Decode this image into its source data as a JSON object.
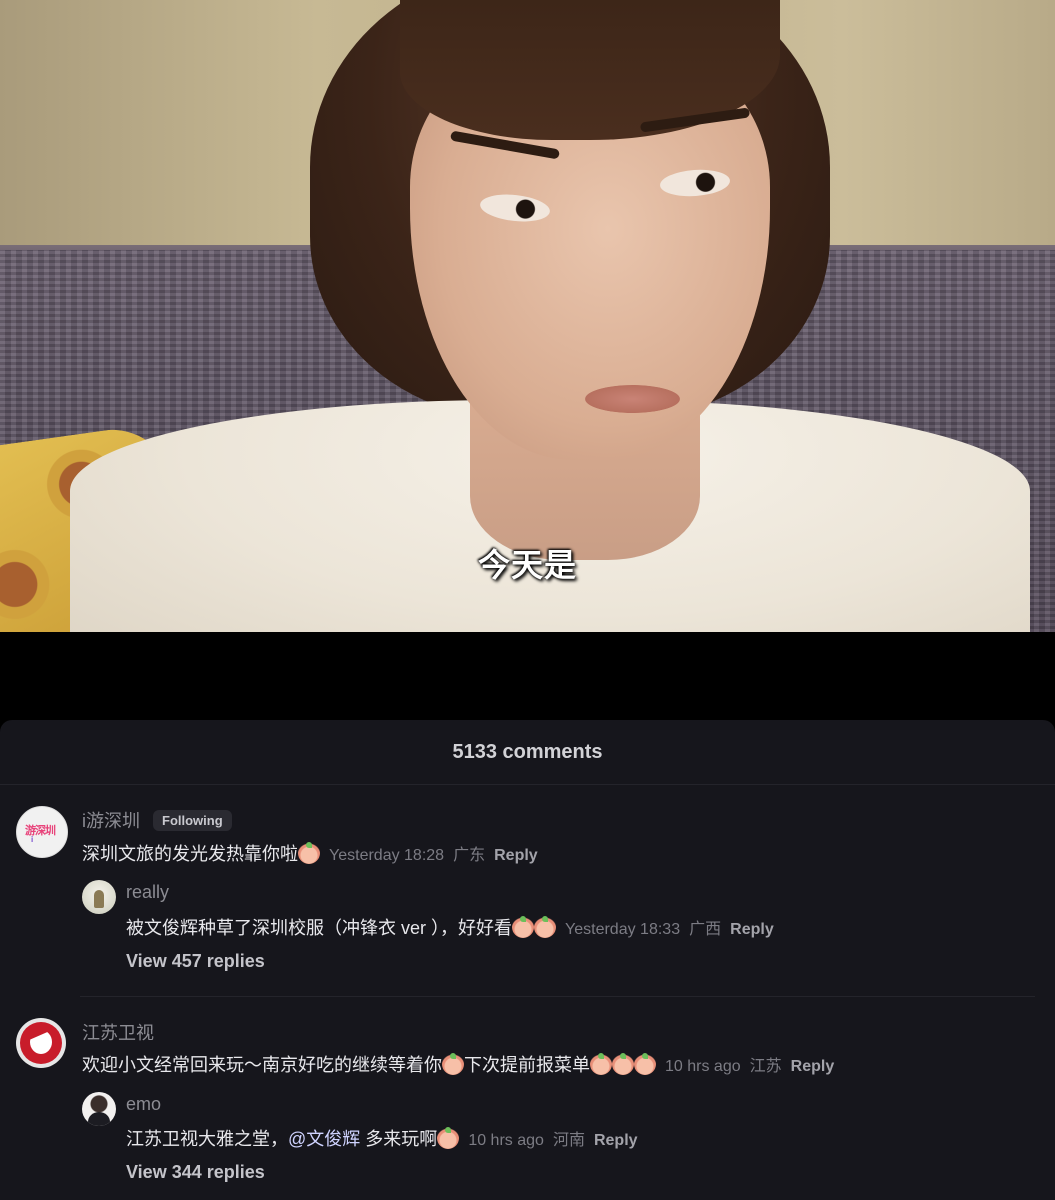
{
  "video": {
    "subtitle": "今天是"
  },
  "comments_panel": {
    "title": "5133 comments",
    "threads": [
      {
        "author": "i游深圳",
        "avatar_text": "游深圳",
        "avatar_subtext": "i",
        "badge": "Following",
        "text": "深圳文旅的发光发热靠你啦",
        "time": "Yesterday 18:28",
        "location": "广东",
        "reply_label": "Reply",
        "reply": {
          "author": "really",
          "text": "被文俊辉种草了深圳校服（冲锋衣 ver ），好好看",
          "time": "Yesterday 18:33",
          "location": "广西",
          "reply_label": "Reply"
        },
        "view_replies": "View 457 replies"
      },
      {
        "author": "江苏卫视",
        "text_a": "欢迎小文经常回来玩～南京好吃的继续等着你",
        "text_b": "下次提前报菜单",
        "time": "10 hrs ago",
        "location": "江苏",
        "reply_label": "Reply",
        "reply": {
          "author": "emo",
          "text_a": "江苏卫视大雅之堂，",
          "mention": "@文俊辉",
          "text_b": " 多来玩啊",
          "time": "10 hrs ago",
          "location": "河南",
          "reply_label": "Reply"
        },
        "view_replies": "View 344 replies"
      }
    ]
  }
}
